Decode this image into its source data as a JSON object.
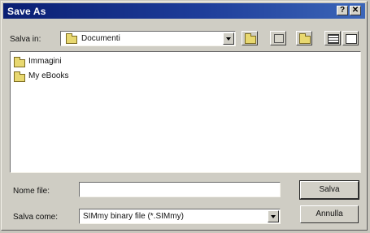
{
  "window": {
    "title": "Save As"
  },
  "title_buttons": {
    "help": "?",
    "close": "✕"
  },
  "toolbar": {
    "save_in_label": "Salva in:",
    "save_in_value": "Documenti",
    "icons": [
      "up-folder-icon",
      "desktop-icon",
      "new-folder-icon",
      "list-view-icon",
      "details-view-icon"
    ]
  },
  "files": [
    {
      "name": "Immagini",
      "icon": "folder-icon"
    },
    {
      "name": "My eBooks",
      "icon": "folder-icon"
    }
  ],
  "form": {
    "filename_label": "Nome file:",
    "filename_value": "",
    "savetype_label": "Salva come:",
    "savetype_value": "SIMmy binary file (*.SIMmy)"
  },
  "buttons": {
    "save": "Salva",
    "cancel": "Annulla"
  }
}
